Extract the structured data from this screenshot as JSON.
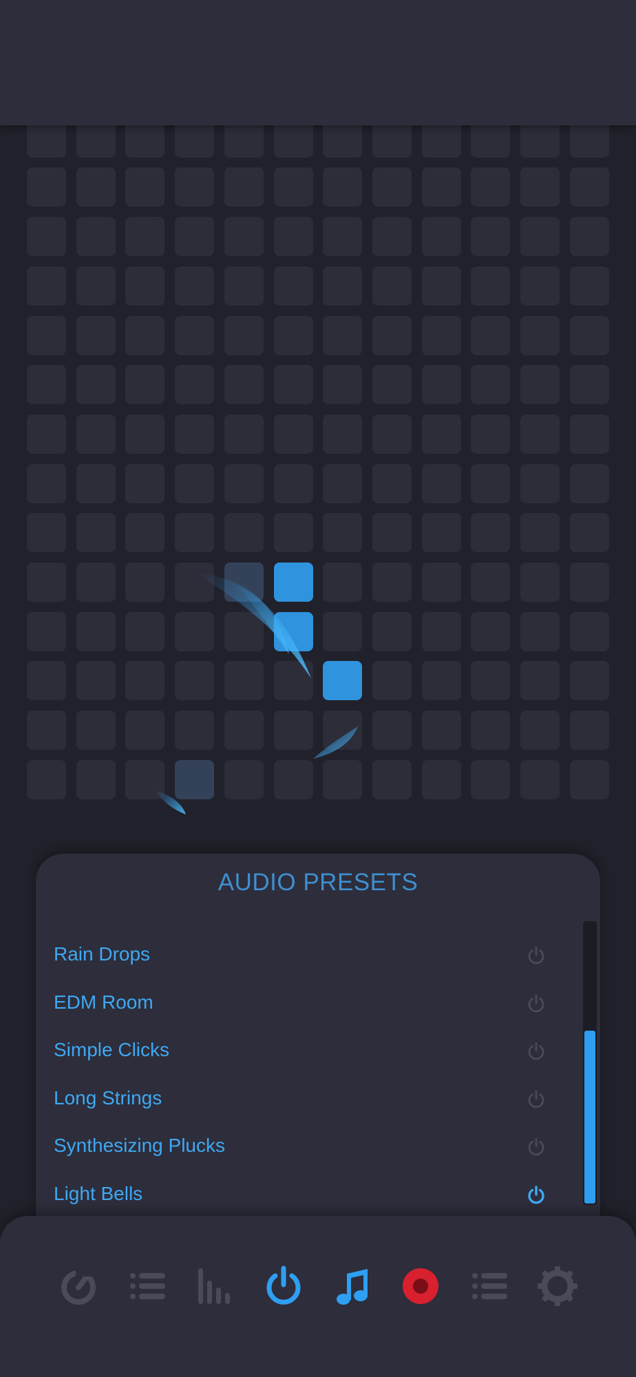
{
  "grid": {
    "columns": 12,
    "rows": 15,
    "active_cells": [
      [
        10,
        5
      ],
      [
        11,
        5
      ],
      [
        12,
        6
      ]
    ],
    "faded_cells": [
      [
        10,
        4
      ],
      [
        14,
        3
      ]
    ]
  },
  "presets": {
    "title": "AUDIO PRESETS",
    "items": [
      {
        "label": "Rain Drops",
        "active": false
      },
      {
        "label": "EDM Room",
        "active": false
      },
      {
        "label": "Simple Clicks",
        "active": false
      },
      {
        "label": "Long Strings",
        "active": false
      },
      {
        "label": "Synthesizing Plucks",
        "active": false
      },
      {
        "label": "Light Bells",
        "active": true
      }
    ],
    "scroll": {
      "position": 0.38,
      "visible_fraction": 0.62
    }
  },
  "nav": {
    "items": [
      {
        "icon": "gauge-icon",
        "active": false
      },
      {
        "icon": "list-icon",
        "active": false
      },
      {
        "icon": "equalizer-icon",
        "active": false
      },
      {
        "icon": "power-icon",
        "active": true
      },
      {
        "icon": "music-note-icon",
        "active": true
      },
      {
        "icon": "record-icon",
        "active": true
      },
      {
        "icon": "list-icon",
        "active": false
      },
      {
        "icon": "settings-icon",
        "active": false
      }
    ]
  },
  "colors": {
    "background": "#21212b",
    "panel": "#2d2d3b",
    "cell": "#2d2d3a",
    "accent": "#2f93de",
    "accent_bright": "#3fa8f2",
    "record": "#d8202f",
    "inactive_icon": "#4a4a58"
  }
}
